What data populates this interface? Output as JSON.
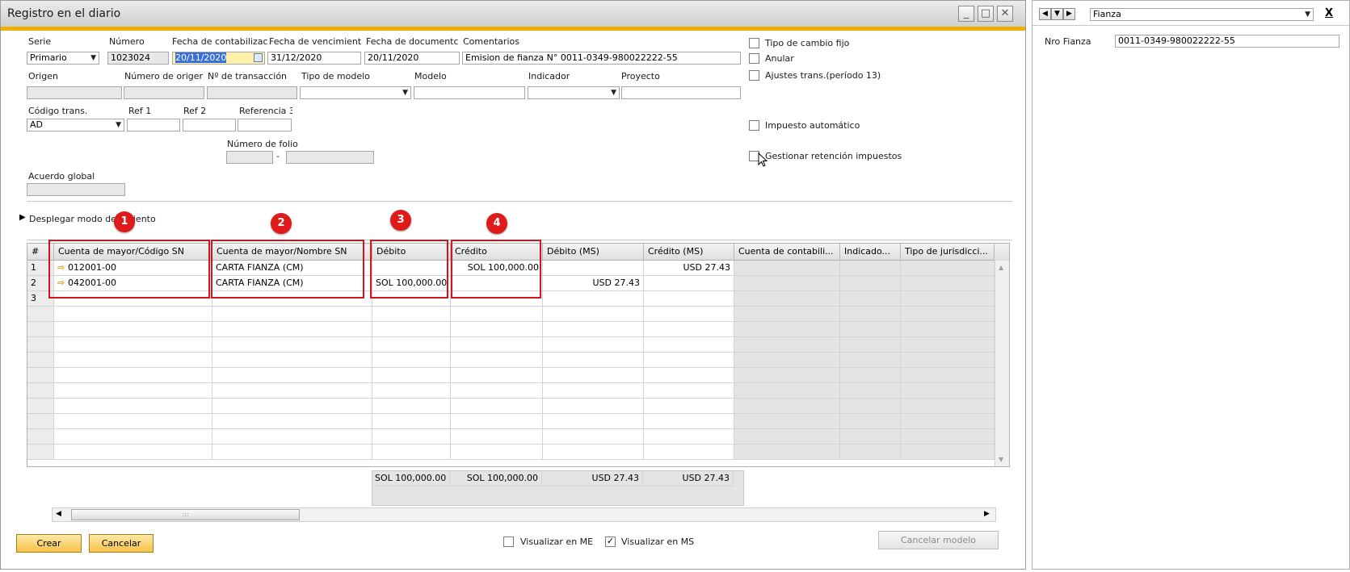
{
  "window": {
    "title": "Registro en el diario"
  },
  "header": {
    "serie_label": "Serie",
    "serie_value": "Primario",
    "numero_label": "Número",
    "numero_value": "1023024",
    "fecha_contab_label": "Fecha de contabilizac",
    "fecha_contab_value": "20/11/2020",
    "fecha_venc_label": "Fecha de vencimient",
    "fecha_venc_value": "31/12/2020",
    "fecha_doc_label": "Fecha de documentc",
    "fecha_doc_value": "20/11/2020",
    "comentarios_label": "Comentarios",
    "comentarios_value": "Emision de fianza N° 0011-0349-980022222-55",
    "origen_label": "Origen",
    "num_origen_label": "Número de origer",
    "num_trans_label": "Nº de transacción",
    "tipo_modelo_label": "Tipo de modelo",
    "modelo_label": "Modelo",
    "indicador_label": "Indicador",
    "proyecto_label": "Proyecto",
    "codigo_trans_label": "Código trans.",
    "codigo_trans_value": "AD",
    "ref1_label": "Ref 1",
    "ref2_label": "Ref 2",
    "ref3_label": "Referencia 3",
    "num_folio_label": "Número de folio",
    "folio_sep": "-",
    "acuerdo_label": "Acuerdo global"
  },
  "checks": {
    "tipo_cambio": "Tipo de cambio fijo",
    "anular": "Anular",
    "ajustes": "Ajustes trans.(período 13)",
    "impuesto": "Impuesto automático",
    "retencion": "Gestionar retención impuestos"
  },
  "expander_label": "Desplegar modo de          amiento",
  "badges": [
    "1",
    "2",
    "3",
    "4"
  ],
  "grid": {
    "columns": [
      "#",
      "Cuenta de mayor/Código SN",
      "Cuenta de mayor/Nombre SN",
      "Débito",
      "Crédito",
      "Débito (MS)",
      "Crédito (MS)",
      "Cuenta de contabili...",
      "Indicado...",
      "Tipo de jurisdicci..."
    ],
    "rows": [
      {
        "num": "1",
        "cuenta": "012001-00",
        "nombre": "CARTA FIANZA (CM)",
        "debito": "",
        "credito": "SOL 100,000.00",
        "debito_ms": "",
        "credito_ms": "USD 27.43"
      },
      {
        "num": "2",
        "cuenta": "042001-00",
        "nombre": "CARTA FIANZA (CM)",
        "debito": "SOL 100,000.00",
        "credito": "",
        "debito_ms": "USD 27.43",
        "credito_ms": ""
      },
      {
        "num": "3",
        "cuenta": "",
        "nombre": "",
        "debito": "",
        "credito": "",
        "debito_ms": "",
        "credito_ms": ""
      }
    ],
    "totals": {
      "debito": "SOL 100,000.00",
      "credito": "SOL 100,000.00",
      "debito_ms": "USD 27.43",
      "credito_ms": "USD 27.43"
    }
  },
  "footer": {
    "crear": "Crear",
    "cancelar": "Cancelar",
    "visualizar_me": "Visualizar en ME",
    "visualizar_ms": "Visualizar en MS",
    "cancelar_modelo": "Cancelar modelo",
    "scroll_grip": ":::"
  },
  "side": {
    "selector_value": "Fianza",
    "close": "X",
    "nro_label": "Nro Fianza",
    "nro_value": "0011-0349-980022222-55"
  },
  "colors": {
    "accent": "#f0b000",
    "highlight": "#d6141b",
    "button": "#f7c24a"
  }
}
